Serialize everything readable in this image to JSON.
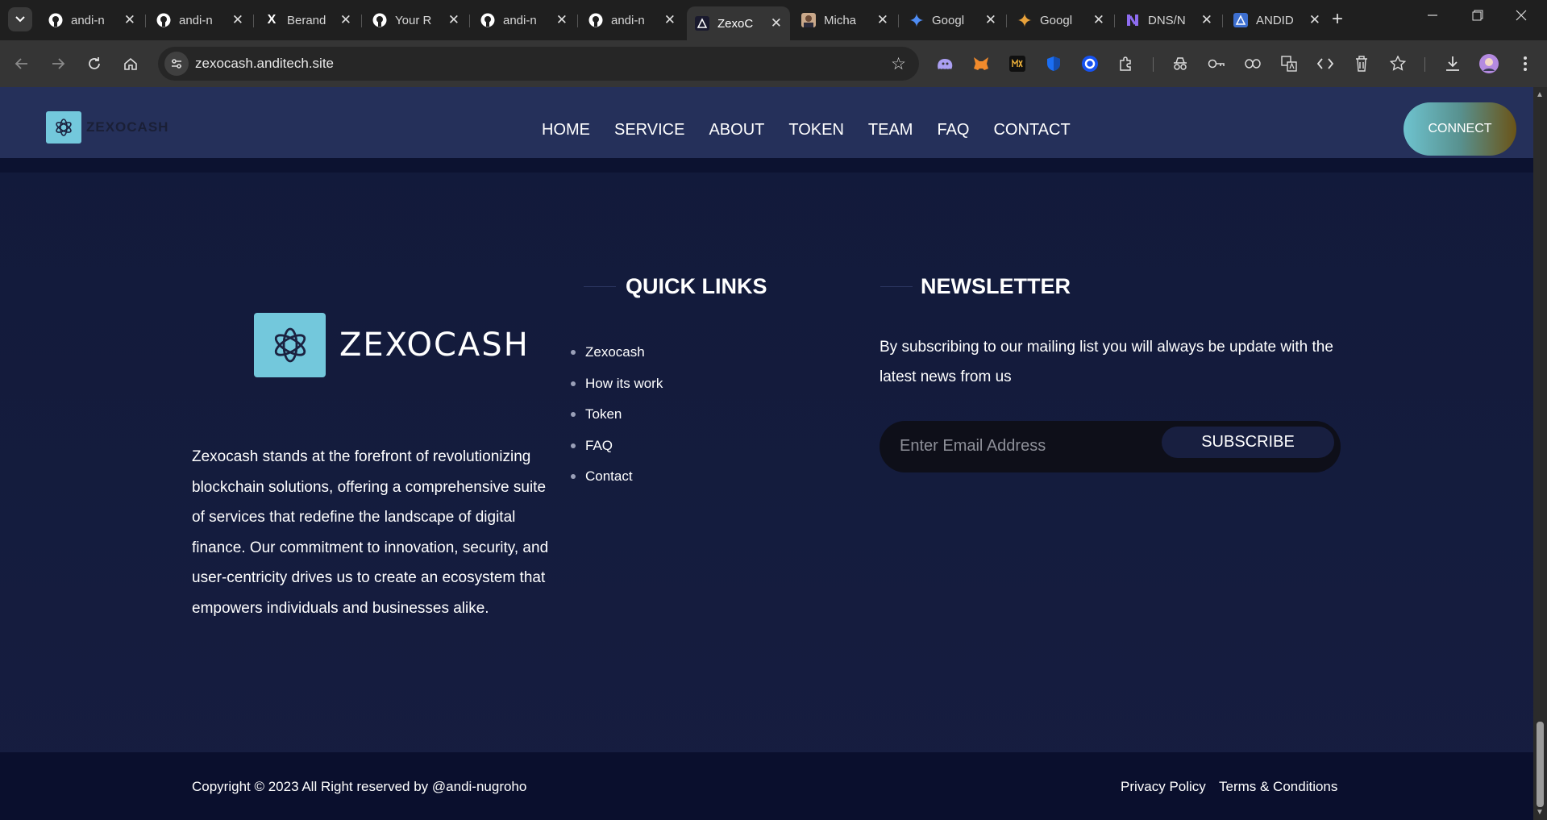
{
  "browser": {
    "tabs": [
      {
        "title": "andi-n",
        "favicon": "github-icon"
      },
      {
        "title": "andi-n",
        "favicon": "github-icon"
      },
      {
        "title": "Berand",
        "favicon": "x-icon"
      },
      {
        "title": "Your R",
        "favicon": "github-icon"
      },
      {
        "title": "andi-n",
        "favicon": "github-icon"
      },
      {
        "title": "andi-n",
        "favicon": "github-icon"
      },
      {
        "title": "ZexoC",
        "favicon": "zexocash-icon",
        "active": true
      },
      {
        "title": "Micha",
        "favicon": "avatar-icon"
      },
      {
        "title": "Googl",
        "favicon": "gemini-icon"
      },
      {
        "title": "Googl",
        "favicon": "gemini-icon"
      },
      {
        "title": "DNS/N",
        "favicon": "dns-icon"
      },
      {
        "title": "ANDID",
        "favicon": "andid-icon"
      }
    ],
    "close_glyph": "✕",
    "new_tab_glyph": "+",
    "url": "zexocash.anditech.site"
  },
  "header": {
    "logo_text": "ZEXOCASH",
    "menu": [
      {
        "label": "HOME"
      },
      {
        "label": "SERVICE"
      },
      {
        "label": "ABOUT"
      },
      {
        "label": "TOKEN"
      },
      {
        "label": "TEAM"
      },
      {
        "label": "FAQ"
      },
      {
        "label": "CONTACT"
      }
    ],
    "connect_label": "CONNECT"
  },
  "footer": {
    "logo_text": "ZEXOCASH",
    "about": "Zexocash stands at the forefront of revolutionizing blockchain solutions, offering a comprehensive suite of services that redefine the landscape of digital finance. Our commitment to innovation, security, and user-centricity drives us to create an ecosystem that empowers individuals and businesses alike.",
    "quick_links_title": "QUICK LINKS",
    "quick_links": [
      {
        "label": "Zexocash"
      },
      {
        "label": "How its work"
      },
      {
        "label": "Token"
      },
      {
        "label": "FAQ"
      },
      {
        "label": "Contact"
      }
    ],
    "newsletter_title": "NEWSLETTER",
    "newsletter_text": "By subscribing to our mailing list you will always be update with the latest news from us",
    "email_placeholder": "Enter Email Address",
    "subscribe_label": "SUBSCRIBE",
    "copyright": "Copyright © 2023 All Right reserved by @andi-nugroho",
    "privacy_label": "Privacy Policy",
    "terms_label": "Terms & Conditions"
  },
  "colors": {
    "page_bg": "#121a3a",
    "header_bg": "#25305a",
    "logo_bg": "#73c8dc",
    "copyright_bg": "#0a0f2d"
  }
}
